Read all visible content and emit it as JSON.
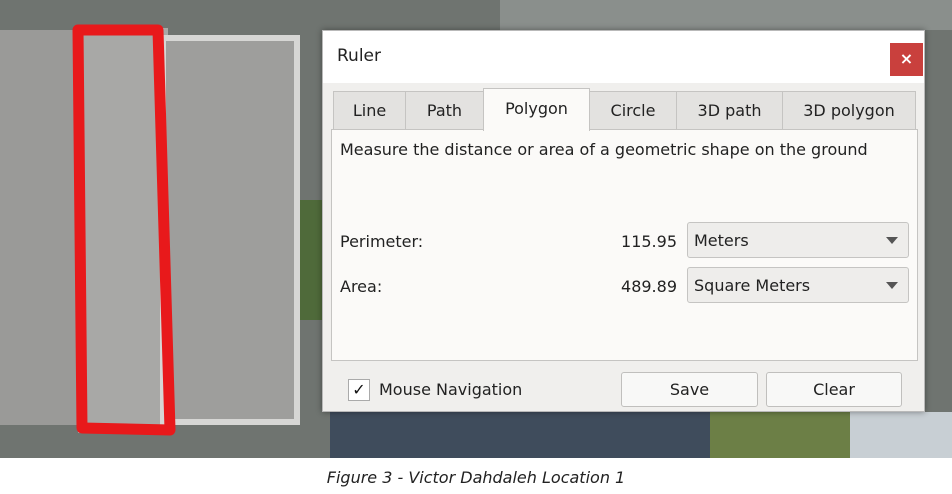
{
  "dialog": {
    "title": "Ruler",
    "close_label": "×",
    "tabs": [
      {
        "label": "Line"
      },
      {
        "label": "Path"
      },
      {
        "label": "Polygon"
      },
      {
        "label": "Circle"
      },
      {
        "label": "3D path"
      },
      {
        "label": "3D polygon"
      }
    ],
    "active_tab": "Polygon",
    "description": "Measure the distance or area of a geometric shape on the ground",
    "perimeter": {
      "label": "Perimeter:",
      "value": "115.95",
      "unit": "Meters"
    },
    "area": {
      "label": "Area:",
      "value": "489.89",
      "unit": "Square Meters"
    },
    "mouse_navigation": {
      "label": "Mouse Navigation",
      "checked": true,
      "check_glyph": "✓"
    },
    "save_label": "Save",
    "clear_label": "Clear"
  },
  "caption": "Figure 3 - Victor Dahdaleh Location 1",
  "colors": {
    "outline": "#e8191b",
    "close": "#c9403d"
  }
}
